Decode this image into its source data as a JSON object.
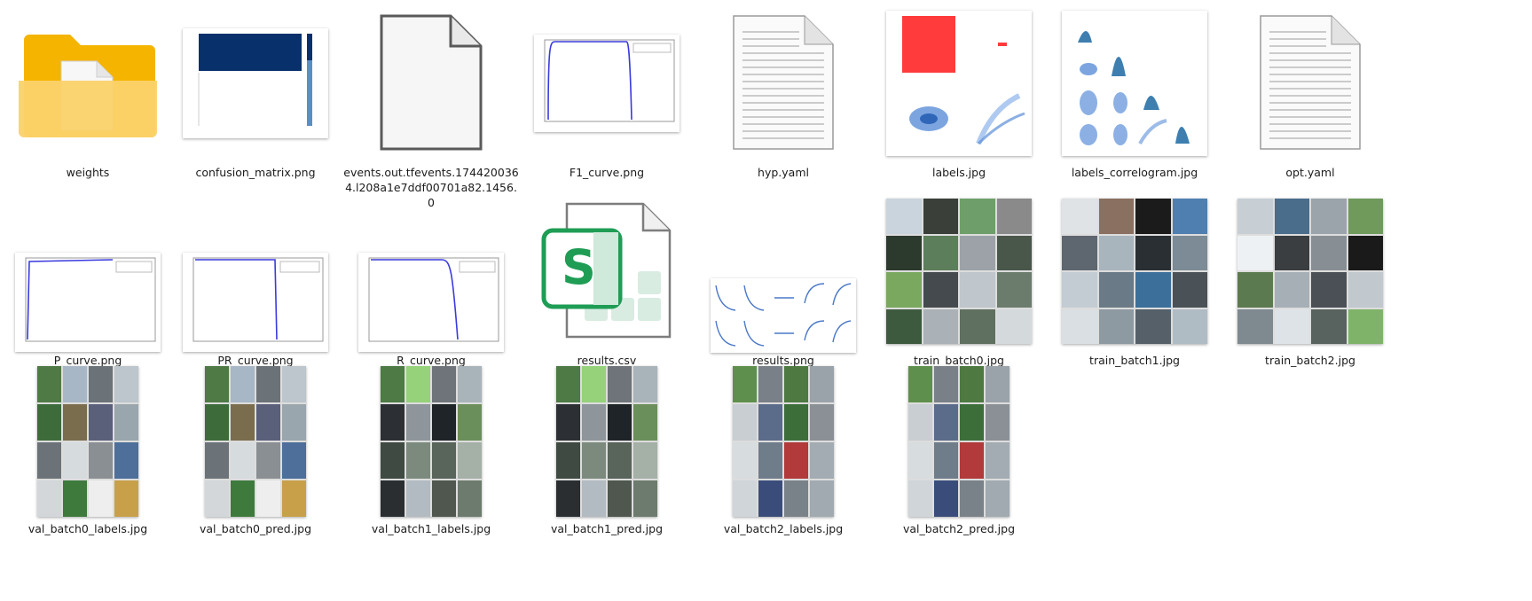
{
  "files": [
    {
      "name": "weights",
      "kind": "folder"
    },
    {
      "name": "confusion_matrix.png",
      "kind": "image-matrix"
    },
    {
      "name": "events.out.tfevents.1744200364.l208a1e7ddf00701a82.1456.0",
      "kind": "generic-file"
    },
    {
      "name": "F1_curve.png",
      "kind": "image-curve"
    },
    {
      "name": "hyp.yaml",
      "kind": "text-file"
    },
    {
      "name": "labels.jpg",
      "kind": "image-labels"
    },
    {
      "name": "labels_correlogram.jpg",
      "kind": "image-correlogram"
    },
    {
      "name": "opt.yaml",
      "kind": "text-file"
    },
    {
      "name": "P_curve.png",
      "kind": "image-curve"
    },
    {
      "name": "PR_curve.png",
      "kind": "image-curve"
    },
    {
      "name": "R_curve.png",
      "kind": "image-curve"
    },
    {
      "name": "results.csv",
      "kind": "spreadsheet"
    },
    {
      "name": "results.png",
      "kind": "image-results"
    },
    {
      "name": "train_batch0.jpg",
      "kind": "image-mosaic"
    },
    {
      "name": "train_batch1.jpg",
      "kind": "image-mosaic"
    },
    {
      "name": "train_batch2.jpg",
      "kind": "image-mosaic"
    },
    {
      "name": "val_batch0_labels.jpg",
      "kind": "image-val"
    },
    {
      "name": "val_batch0_pred.jpg",
      "kind": "image-val"
    },
    {
      "name": "val_batch1_labels.jpg",
      "kind": "image-val"
    },
    {
      "name": "val_batch1_pred.jpg",
      "kind": "image-val"
    },
    {
      "name": "val_batch2_labels.jpg",
      "kind": "image-val"
    },
    {
      "name": "val_batch2_pred.jpg",
      "kind": "image-val"
    }
  ],
  "colors": {
    "folder": "#f8c13e",
    "curve": "#3a3adf",
    "matrix": "#08306b",
    "spreadsheet": "#1f9d55",
    "bar": "#ff3030"
  }
}
